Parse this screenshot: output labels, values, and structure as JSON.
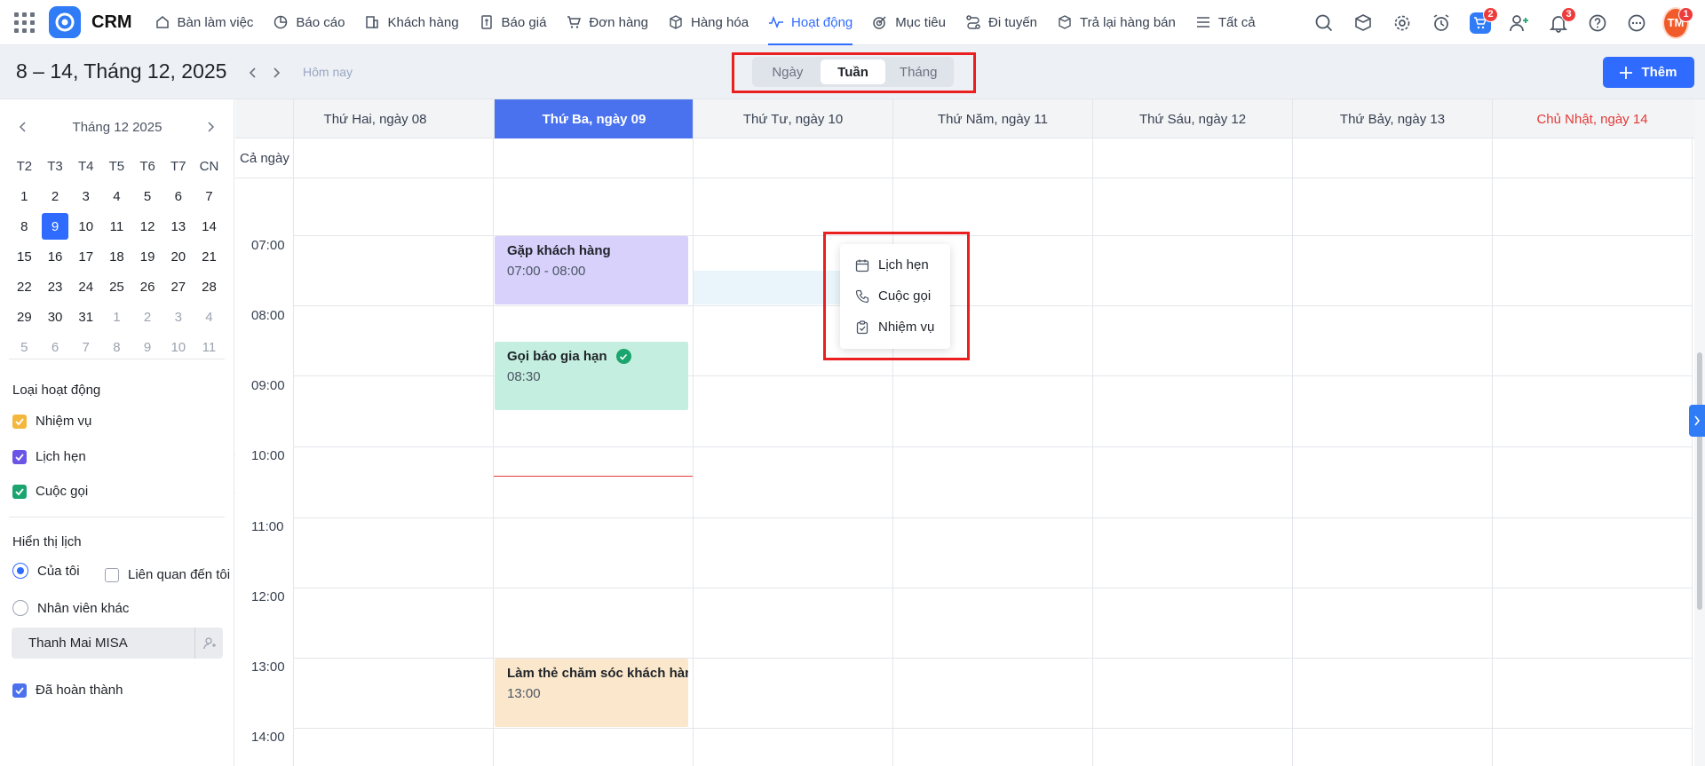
{
  "app": {
    "brand": "CRM"
  },
  "nav": {
    "items": [
      {
        "label": "Bàn làm việc",
        "icon": "home-icon"
      },
      {
        "label": "Báo cáo",
        "icon": "pie-chart-icon"
      },
      {
        "label": "Khách hàng",
        "icon": "building-icon"
      },
      {
        "label": "Báo giá",
        "icon": "document-dollar-icon"
      },
      {
        "label": "Đơn hàng",
        "icon": "cart-icon"
      },
      {
        "label": "Hàng hóa",
        "icon": "box-icon"
      },
      {
        "label": "Hoạt động",
        "icon": "activity-icon",
        "active": true
      },
      {
        "label": "Mục tiêu",
        "icon": "target-icon"
      },
      {
        "label": "Đi tuyến",
        "icon": "route-icon"
      },
      {
        "label": "Trả lại hàng bán",
        "icon": "return-box-icon"
      },
      {
        "label": "Tất cả",
        "icon": "menu-lines-icon"
      }
    ],
    "badges": {
      "cart": "2",
      "notifications": "3",
      "avatar": "1"
    },
    "avatar_initials": "TM"
  },
  "toolbar": {
    "range_title": "8 – 14, Tháng 12, 2025",
    "today": "Hôm nay",
    "views": {
      "day": "Ngày",
      "week": "Tuần",
      "month": "Tháng"
    },
    "add_label": "Thêm"
  },
  "mini_calendar": {
    "title": "Tháng 12 2025",
    "weekdays": [
      "T2",
      "T3",
      "T4",
      "T5",
      "T6",
      "T7",
      "CN"
    ],
    "weeks": [
      [
        "1",
        "2",
        "3",
        "4",
        "5",
        "6",
        "7"
      ],
      [
        "8",
        "9",
        "10",
        "11",
        "12",
        "13",
        "14"
      ],
      [
        "15",
        "16",
        "17",
        "18",
        "19",
        "20",
        "21"
      ],
      [
        "22",
        "23",
        "24",
        "25",
        "26",
        "27",
        "28"
      ],
      [
        "29",
        "30",
        "31",
        "1",
        "2",
        "3",
        "4"
      ],
      [
        "5",
        "6",
        "7",
        "8",
        "9",
        "10",
        "11"
      ]
    ],
    "selected": "9"
  },
  "filters": {
    "activity_types_heading": "Loại hoạt động",
    "types": [
      {
        "label": "Nhiệm vụ",
        "color": "#f4b73e"
      },
      {
        "label": "Lịch hẹn",
        "color": "#6a55e6"
      },
      {
        "label": "Cuộc gọi",
        "color": "#1aa56f"
      }
    ],
    "display_heading": "Hiển thị lịch",
    "mine": "Của tôi",
    "related": "Liên quan đến tôi",
    "other_staff": "Nhân viên khác",
    "staff_value": "Thanh Mai MISA",
    "completed": "Đã hoàn thành"
  },
  "calendar": {
    "days": [
      "Thứ Hai, ngày 08",
      "Thứ Ba, ngày 09",
      "Thứ Tư, ngày 10",
      "Thứ Năm, ngày 11",
      "Thứ Sáu, ngày 12",
      "Thứ Bảy, ngày 13",
      "Chủ Nhật, ngày 14"
    ],
    "all_day": "Cả ngày",
    "hours": [
      "07:00",
      "08:00",
      "09:00",
      "10:00",
      "11:00",
      "12:00",
      "13:00",
      "14:00"
    ],
    "events": [
      {
        "title": "Gặp khách hàng",
        "time": "07:00 - 08:00"
      },
      {
        "title": "Gọi báo gia hạn",
        "time": "08:30"
      },
      {
        "title": "Làm thẻ chăm sóc khách hàng",
        "time": "13:00"
      }
    ]
  },
  "context_menu": {
    "items": [
      {
        "label": "Lịch hẹn",
        "icon": "calendar-icon"
      },
      {
        "label": "Cuộc gọi",
        "icon": "phone-icon"
      },
      {
        "label": "Nhiệm vụ",
        "icon": "clipboard-check-icon"
      }
    ]
  }
}
